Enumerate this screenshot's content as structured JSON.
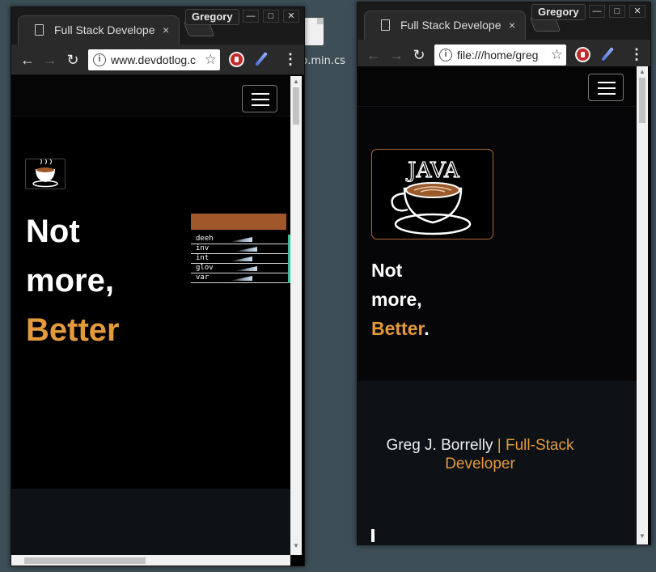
{
  "desktop": {
    "file_label": "p.min.cs"
  },
  "left_window": {
    "user_badge": "Gregory",
    "tab_title": "Full Stack Develope",
    "tab_close": "×",
    "url": "www.devdotlog.c",
    "hero": {
      "line1": "Not",
      "line2": "more,",
      "line3_accent": "Better"
    },
    "overlay": {
      "rows": [
        "deeh",
        "inv",
        "int",
        "glov",
        "var"
      ],
      "accent_color": "#a0582a",
      "meter_color": "#3bbf9a"
    }
  },
  "right_window": {
    "user_badge": "Gregory",
    "tab_title": "Full Stack Develope",
    "tab_close": "×",
    "url": "file:///home/greg",
    "hero": {
      "line1": "Not",
      "line2": "more,",
      "line3_accent": "Better",
      "line3_suffix": "."
    },
    "logo_text": "JAVA",
    "footer": {
      "name": "Greg J. Borrelly",
      "separator": " | ",
      "role": "Full-Stack Developer"
    }
  },
  "controls": {
    "back": "←",
    "forward": "→",
    "reload": "↻",
    "minimize": "—",
    "maximize": "□",
    "close": "✕",
    "info": "i",
    "star": "☆",
    "menu": "⋮"
  },
  "colors": {
    "accent": "#e39a3b",
    "logo_border": "#b0693a",
    "desktop": "#3d4e56"
  }
}
